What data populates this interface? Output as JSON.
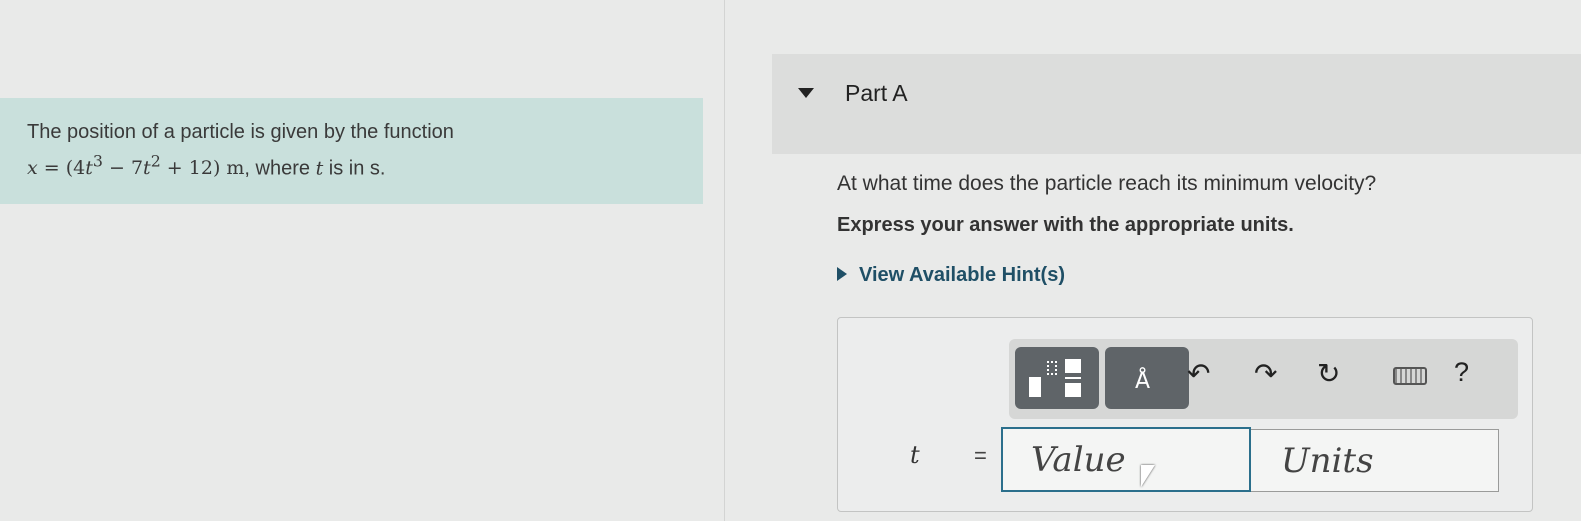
{
  "problem": {
    "text_prefix": "The position of a particle is given by the function",
    "equation": {
      "lhs": "x",
      "eq": " = ",
      "open": "(4",
      "t1": "t",
      "exp1": "3",
      "mid": " − 7",
      "t2": "t",
      "exp2": "2",
      "tail": " + 12) m",
      "comma": ", where ",
      "t3": "t",
      "suffix": " is in s."
    }
  },
  "part": {
    "title": "Part A"
  },
  "question": "At what time does the particle reach its minimum velocity?",
  "instruction": "Express your answer with the appropriate units.",
  "hint_link": "View Available Hint(s)",
  "toolbar": {
    "undo_icon": "↶",
    "redo_icon": "↷",
    "reset_icon": "↻",
    "help_label": "?"
  },
  "answer": {
    "variable": "t",
    "equals": "=",
    "value_placeholder": "Value",
    "units_placeholder": "Units"
  },
  "colors": {
    "problem_bg": "#c9e0dc",
    "accent_border": "#2b6f8c",
    "toolbar_button": "#5f6468",
    "hint_link": "#1f4f66"
  },
  "icons": [
    "templates-icon",
    "symbols-icon",
    "undo-icon",
    "redo-icon",
    "reset-icon",
    "keyboard-icon",
    "help-icon",
    "caret-down-icon",
    "caret-right-icon"
  ]
}
